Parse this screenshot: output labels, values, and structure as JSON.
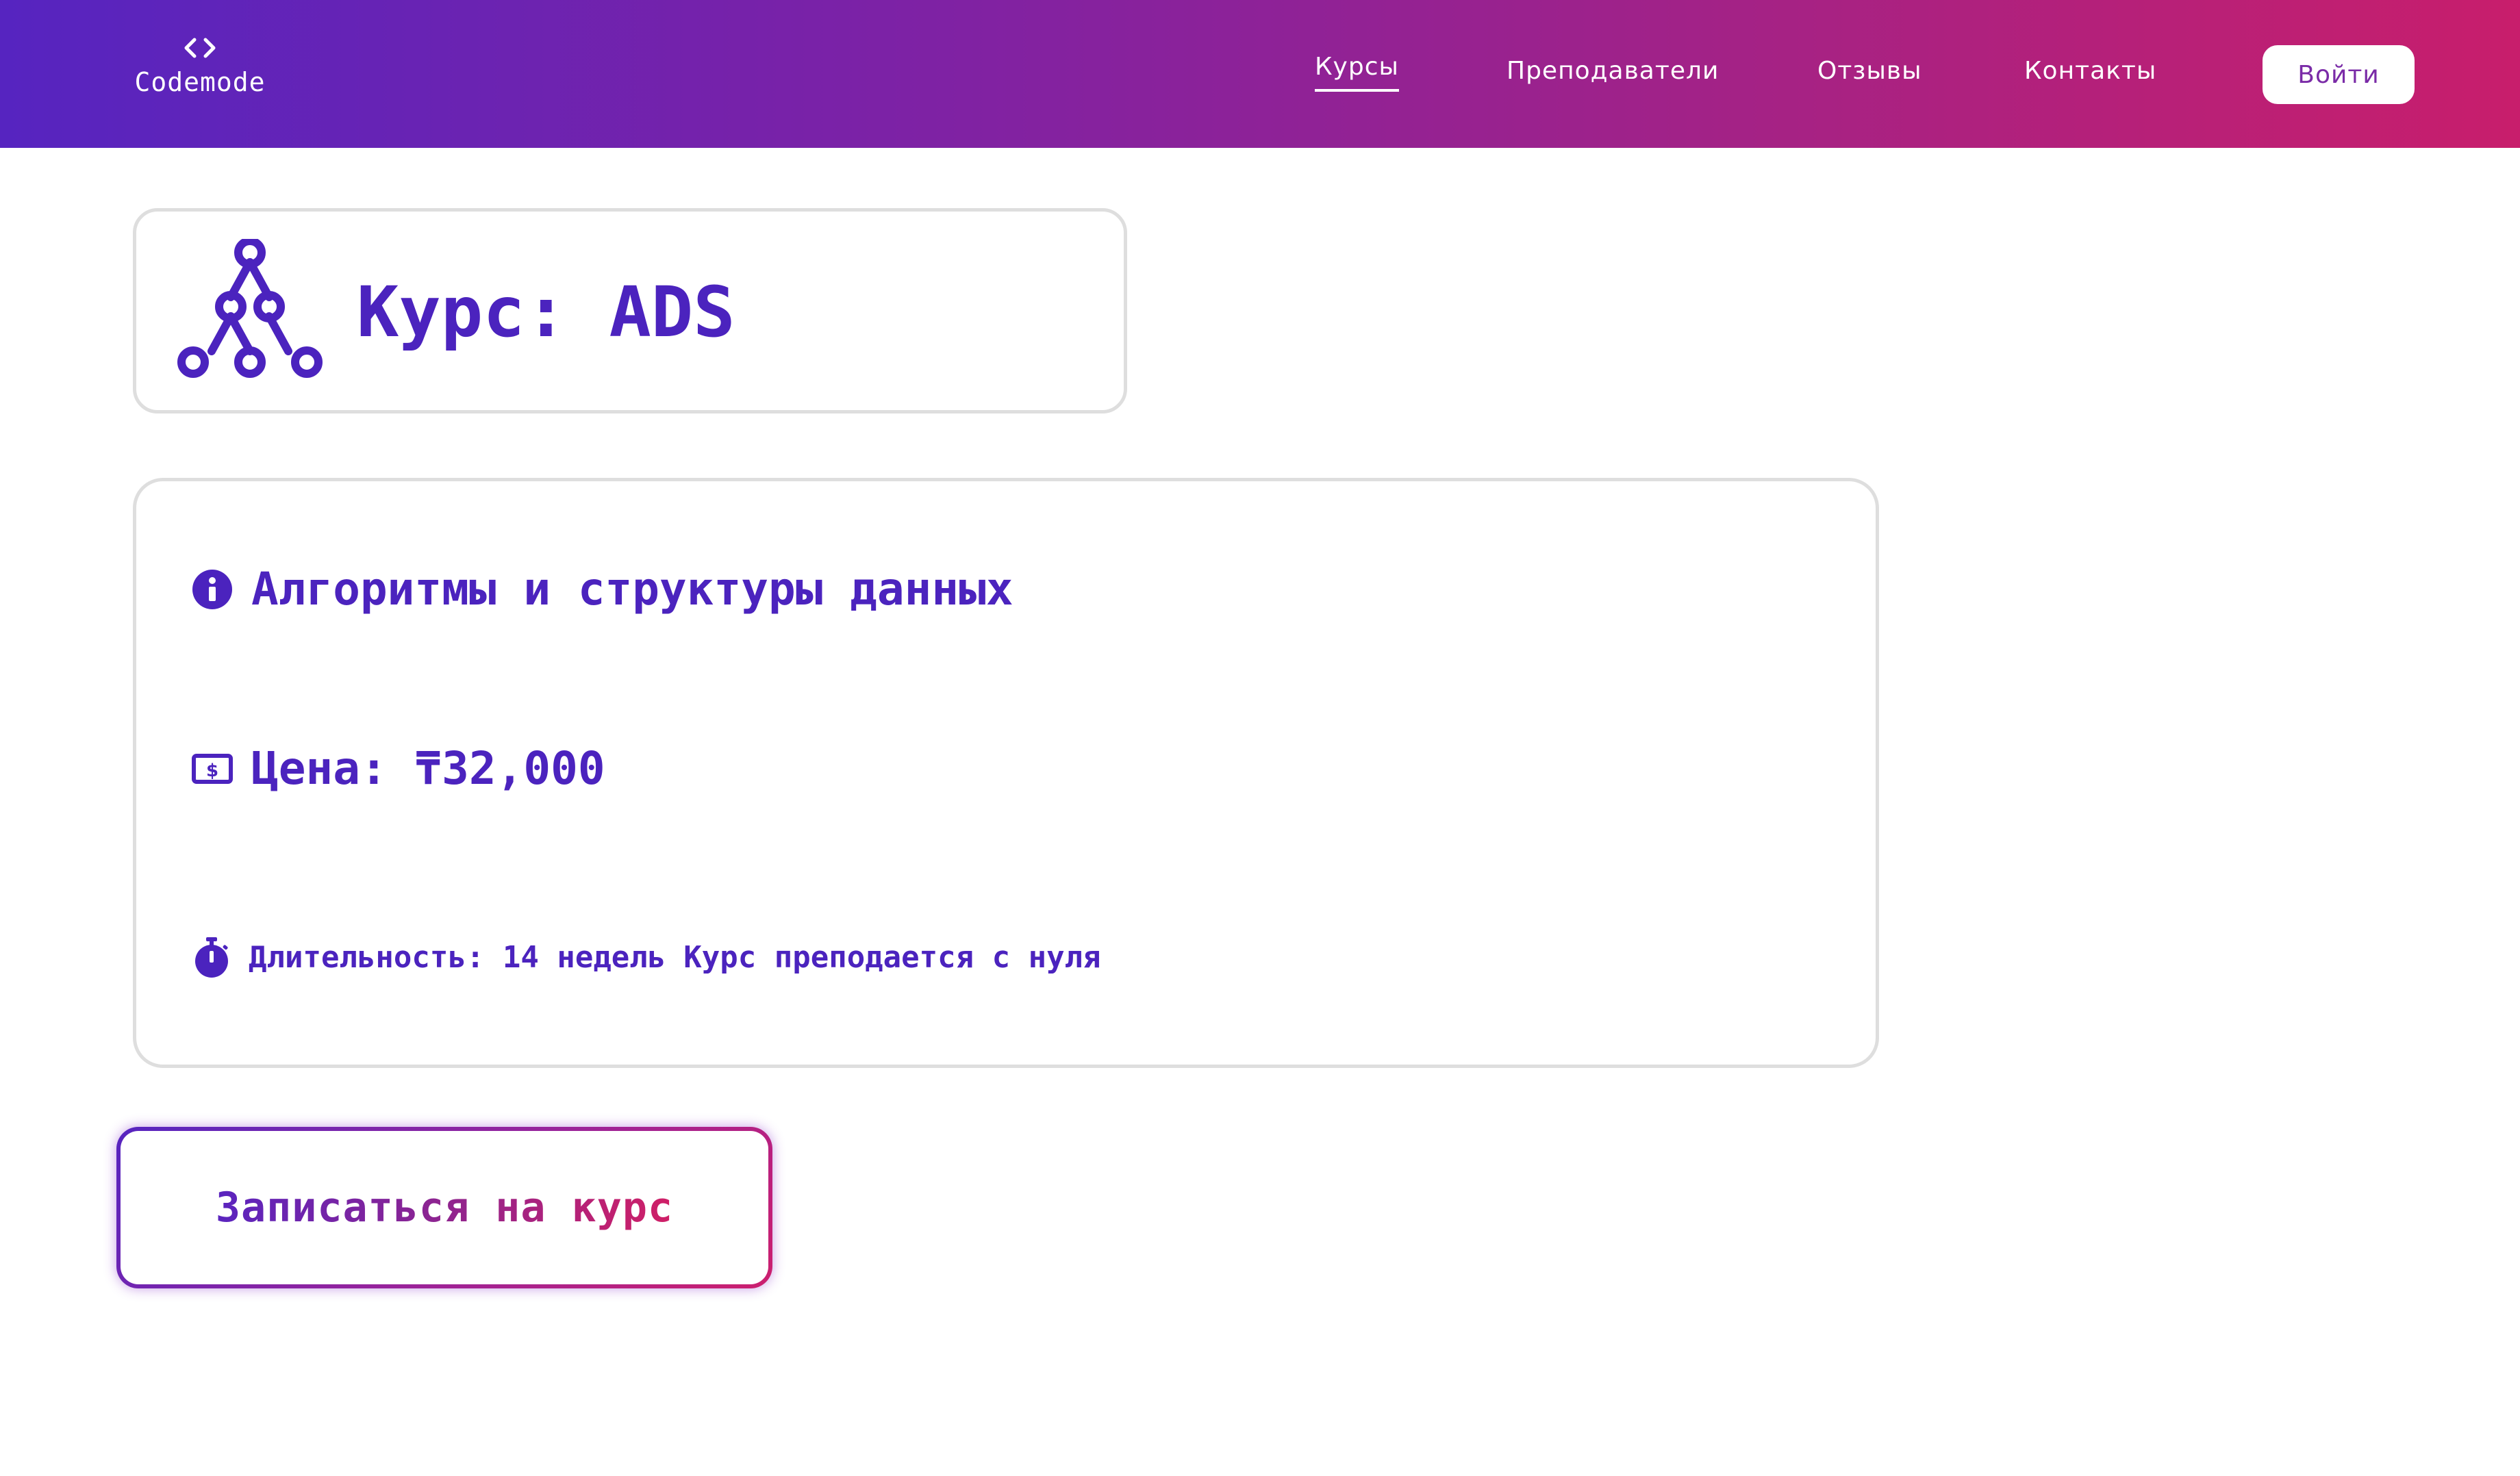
{
  "colors": {
    "accent": "#4b23be",
    "header_gradient_start": "#5624c0",
    "header_gradient_end": "#c81e6c",
    "card_border": "#dedede",
    "login_text": "#7a2ba7"
  },
  "header": {
    "logo_icon": "code-brackets-icon",
    "logo_text": "Codemode",
    "nav": [
      {
        "label": "Курсы",
        "active": true
      },
      {
        "label": "Преподаватели",
        "active": false
      },
      {
        "label": "Отзывы",
        "active": false
      },
      {
        "label": "Контакты",
        "active": false
      }
    ],
    "login_label": "Войти"
  },
  "course": {
    "icon": "tree-structure-icon",
    "title": "Курс: ADS",
    "name_icon": "info-icon",
    "name": "Алгоритмы и структуры данных",
    "price_icon": "money-bill-icon",
    "price": "Цена: ₸32,000",
    "duration_icon": "stopwatch-icon",
    "duration": "Длительность: 14 недель",
    "description": "Курс преподается с нуля"
  },
  "enroll": {
    "label": "Записаться на курс"
  }
}
